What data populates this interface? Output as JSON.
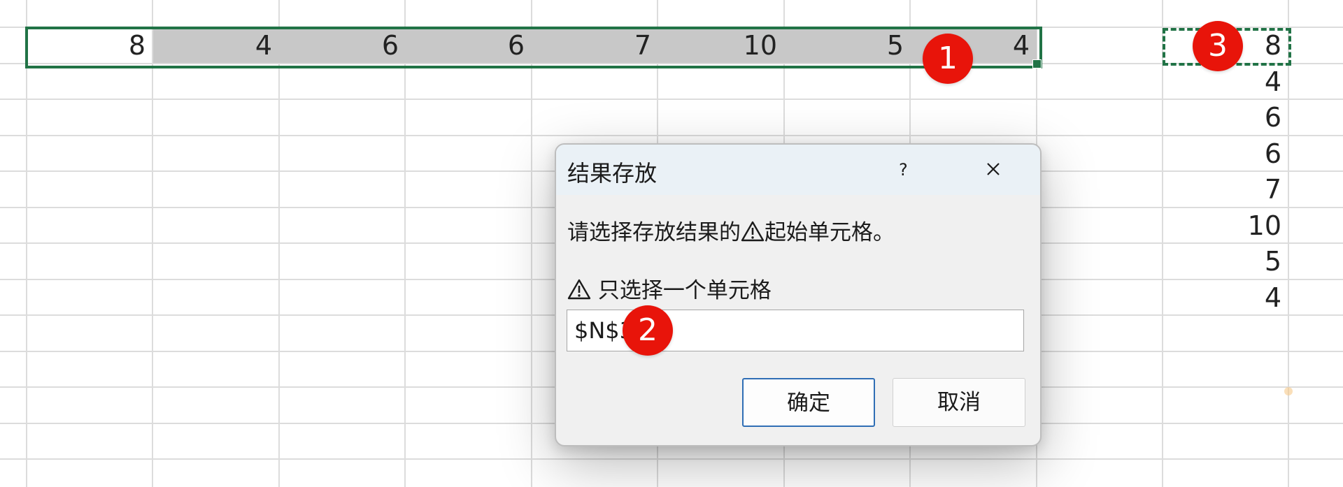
{
  "sheet": {
    "selected_row_values": [
      "8",
      "4",
      "6",
      "6",
      "7",
      "10",
      "5",
      "4"
    ],
    "result_column_values": [
      "8",
      "4",
      "6",
      "6",
      "7",
      "10",
      "5",
      "4"
    ]
  },
  "badges": {
    "one": "1",
    "two": "2",
    "three": "3"
  },
  "dialog": {
    "title": "结果存放",
    "help_label": "?",
    "prompt_before_icon": "请选择存放结果的",
    "prompt_after_icon": "起始单元格。",
    "hint": "只选择一个单元格",
    "input_value": "$N$3",
    "ok_label": "确定",
    "cancel_label": "取消"
  },
  "colors": {
    "selection_border": "#217346",
    "badge": "#e8140a",
    "dialog_background": "#f0f0f0",
    "ok_border": "#2f6eb5"
  },
  "icons": {
    "close": "close-icon",
    "help": "help-icon",
    "warning": "warning-icon"
  }
}
